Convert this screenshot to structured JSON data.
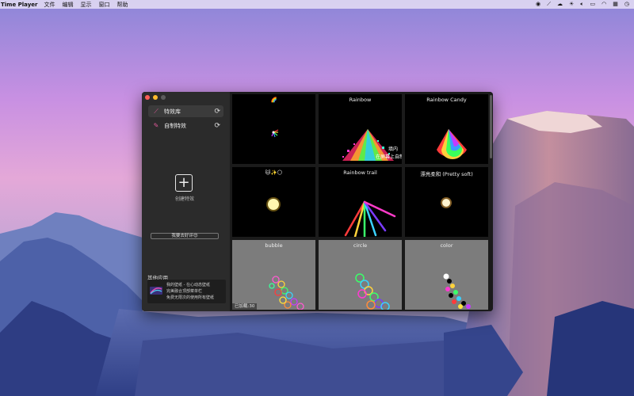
{
  "menubar": {
    "app_name": "Time Player",
    "menus": [
      "文件",
      "编辑",
      "显示",
      "窗口",
      "帮助"
    ],
    "status_icons": [
      "record-icon",
      "wand-icon",
      "wechat-icon",
      "brightness-icon",
      "volume-icon",
      "battery-icon",
      "wifi-icon",
      "grid-icon",
      "clock-icon"
    ]
  },
  "sidebar": {
    "items": [
      {
        "label": "特效库",
        "icon": "wand-icon"
      },
      {
        "label": "自制特效",
        "icon": "pen-icon"
      }
    ],
    "create": {
      "symbol": "+",
      "label": "创建特效"
    },
    "review_label": "我要去好评😍",
    "other_apps_title": "其他应用",
    "promo": {
      "line1": "我的壁纸 - 在心动态壁纸",
      "line2": "完美融合顶部菜单栏",
      "line3": "免费无限次的使用所有壁纸"
    }
  },
  "tiles": [
    {
      "title": "🌈",
      "style": "black"
    },
    {
      "title": "Rainbow",
      "style": "black",
      "overlay_1": "填内",
      "overlay_2": "在屏幕上自制"
    },
    {
      "title": "Rainbow Candy",
      "style": "black"
    },
    {
      "title": "🐱✨🌕",
      "style": "black"
    },
    {
      "title": "Rainbow trail",
      "style": "black"
    },
    {
      "title": "漂亮柔和 (Pretty soft)",
      "style": "black"
    },
    {
      "title": "bubble",
      "style": "gray"
    },
    {
      "title": "circle",
      "style": "gray"
    },
    {
      "title": "color",
      "style": "gray"
    }
  ],
  "loaded_count": "已加载:30",
  "colors": {
    "sidebar_bg": "#2b2b2b",
    "grid_bg": "#1b1b1b",
    "tile_gray": "#7c7c7c",
    "traffic_red": "#ff5f57",
    "traffic_yellow": "#febc2e"
  }
}
